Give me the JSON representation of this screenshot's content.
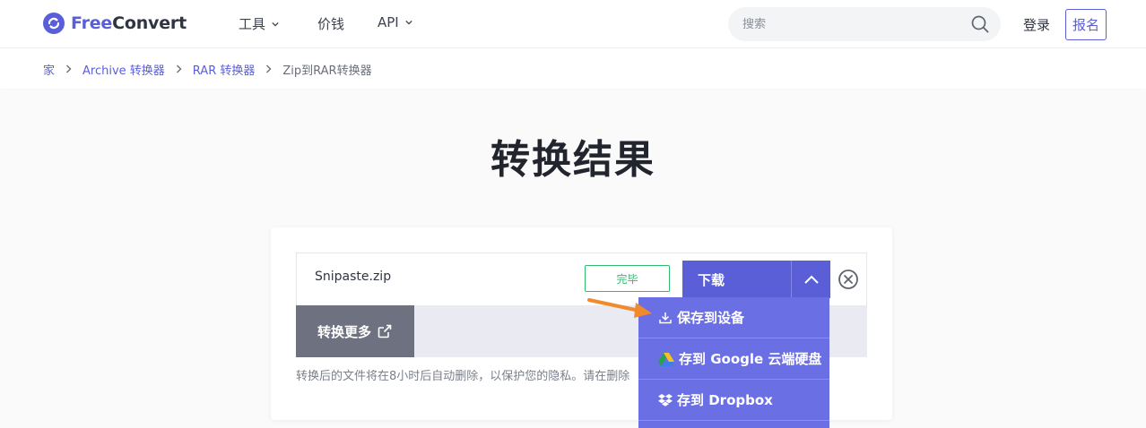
{
  "header": {
    "logo_free": "Free",
    "logo_convert": "Convert",
    "nav": [
      {
        "label": "工具",
        "has_dropdown": true
      },
      {
        "label": "价钱",
        "has_dropdown": false
      },
      {
        "label": "API",
        "has_dropdown": true
      }
    ],
    "search_placeholder": "搜索",
    "login_label": "登录",
    "signup_label": "报名"
  },
  "breadcrumb": [
    "家",
    "Archive 转换器",
    "RAR 转换器",
    "Zip到RAR转换器"
  ],
  "page_title": "转换结果",
  "file": {
    "name": "Snipaste.zip",
    "status": "完毕",
    "download_label": "下载"
  },
  "convert_more_label": "转换更多",
  "note": "转换后的文件将在8小时后自动删除，以保护您的隐私。请在删除",
  "download_menu": [
    {
      "label": "保存到设备",
      "icon": "download-icon"
    },
    {
      "label": "存到 Google 云端硬盘",
      "icon": "google-drive-icon"
    },
    {
      "label": "存到 Dropbox",
      "icon": "dropbox-icon"
    }
  ],
  "colors": {
    "brand": "#5a5fd8",
    "menu_bg": "#6a6fe3",
    "status_green": "#2ebd6b",
    "annotation_arrow": "#f08a2c"
  }
}
